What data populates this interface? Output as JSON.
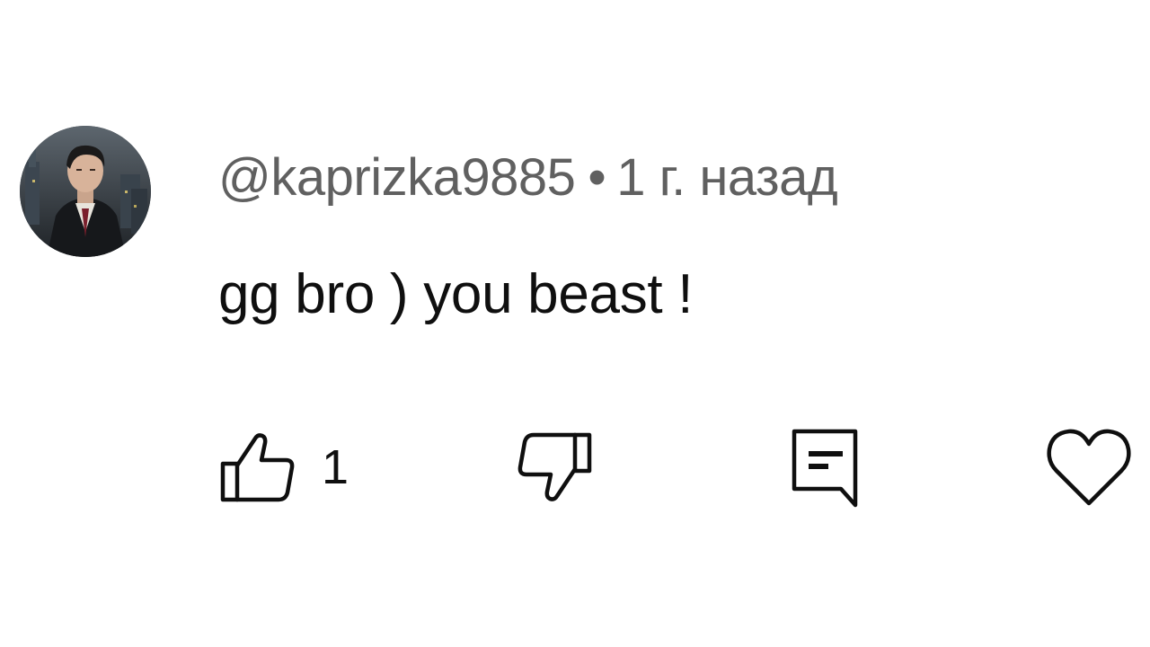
{
  "comment": {
    "author": "@kaprizka9885",
    "separator": "•",
    "time": "1 г. назад",
    "text": "gg bro ) you beast !",
    "like_count": "1"
  },
  "icons": {
    "like": "thumbs-up-icon",
    "dislike": "thumbs-down-icon",
    "reply": "reply-comment-icon",
    "heart": "heart-outline-icon"
  },
  "colors": {
    "text_primary": "#0f0f0f",
    "text_secondary": "#606060",
    "background": "#ffffff"
  }
}
